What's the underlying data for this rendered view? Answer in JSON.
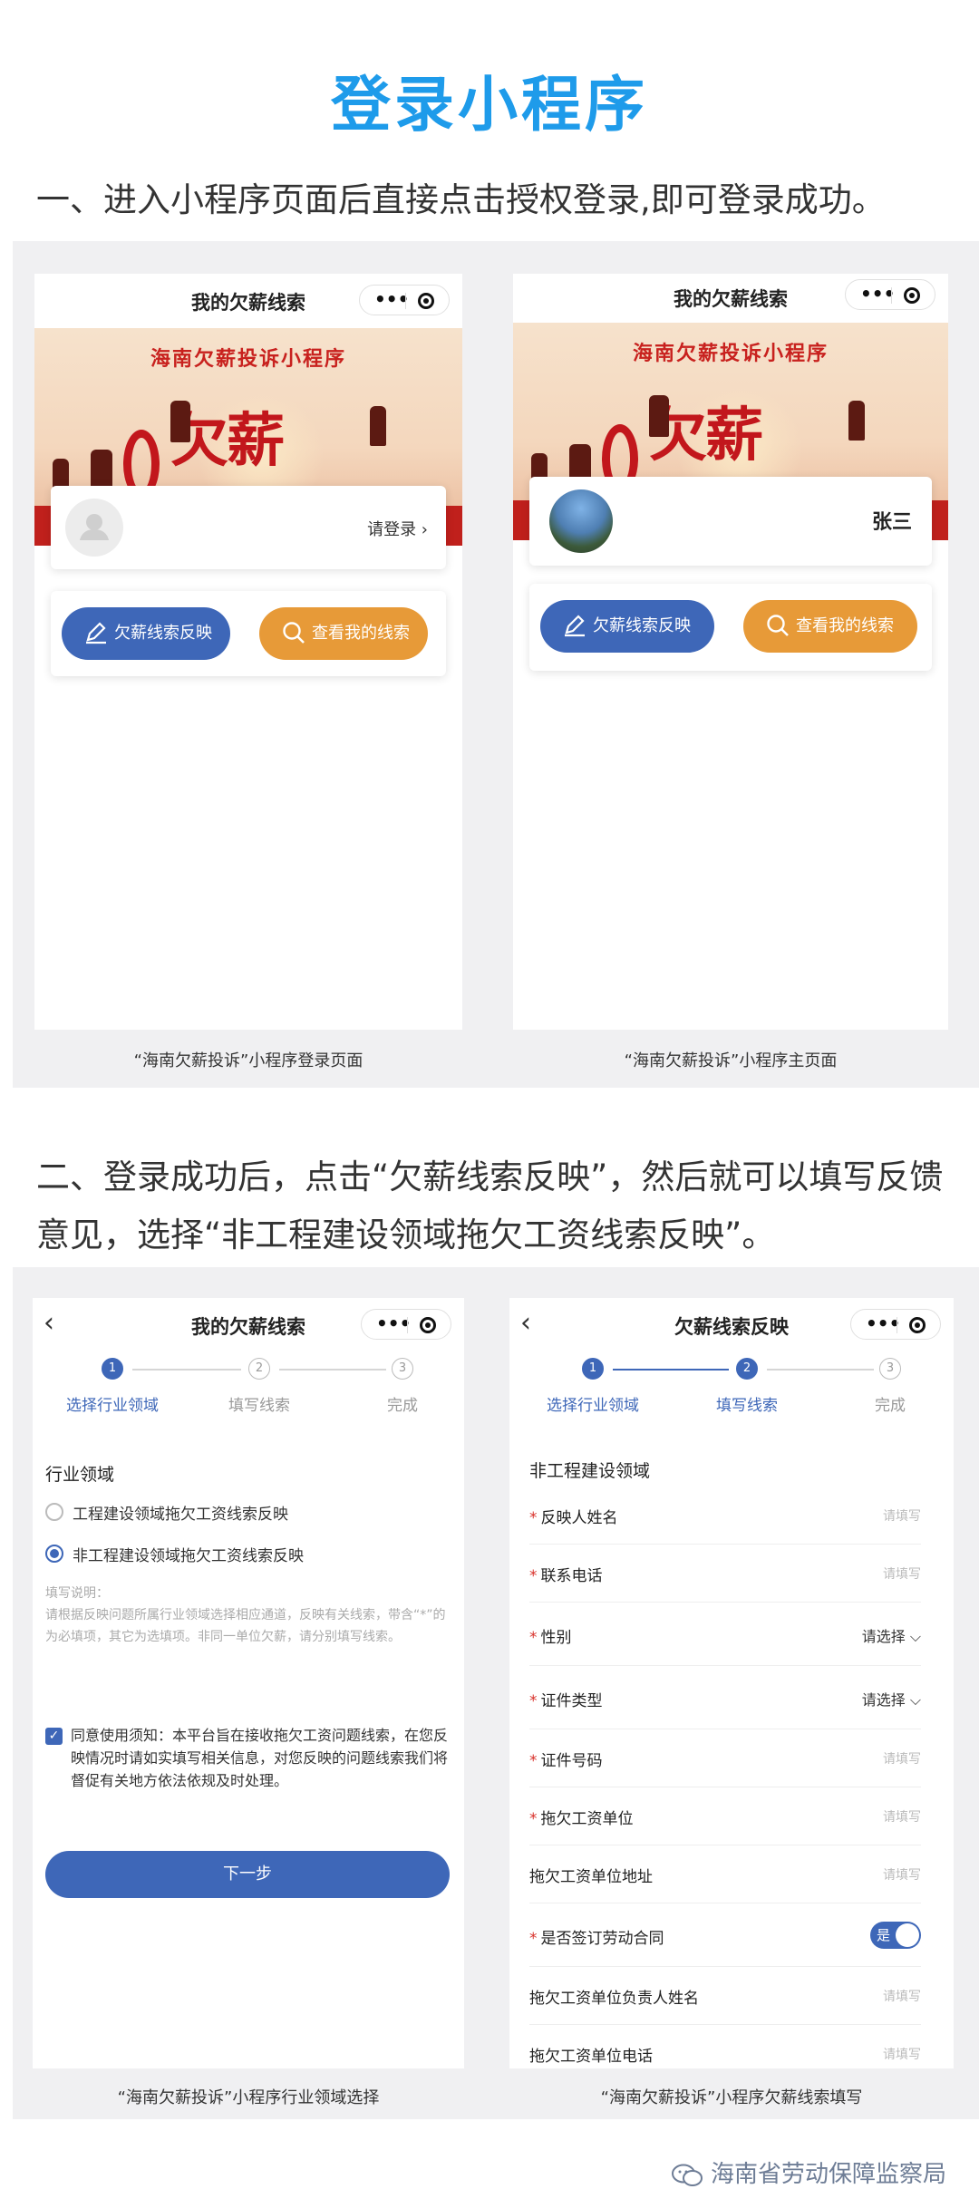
{
  "title": "登录小程序",
  "step1": "一、进入小程序页面后直接点击授权登录,即可登录成功。",
  "step2_line1": "二、登录成功后，点击“欠薪线索反映”，然后就可以填写反馈",
  "step2_line2": "意见，选择“非工程建设领域拖欠工资线索反映”。",
  "phone1": {
    "title": "我的欠薪线索",
    "banner": "海南欠薪投诉小程序",
    "big": "欠薪",
    "login": "请登录 ›",
    "btn_report": "欠薪线索反映",
    "btn_view": "查看我的线索",
    "caption": "“海南欠薪投诉”小程序登录页面"
  },
  "phone2": {
    "title": "我的欠薪线索",
    "banner": "海南欠薪投诉小程序",
    "big": "欠薪",
    "name": "张三",
    "btn_report": "欠薪线索反映",
    "btn_view": "查看我的线索",
    "caption": "“海南欠薪投诉”小程序主页面"
  },
  "phone3": {
    "title": "我的欠薪线索",
    "steps": [
      "选择行业领域",
      "填写线索",
      "完成"
    ],
    "section": "行业领域",
    "option1": "工程建设领域拖欠工资线索反映",
    "option2": "非工程建设领域拖欠工资线索反映",
    "hint_title": "填写说明：",
    "hint_body": "请根据反映问题所属行业领域选择相应通道，反映有关线索，带含“*”的为必填项，其它为选填项。非同一单位欠薪，请分别填写线索。",
    "notice": "同意使用须知：本平台旨在接收拖欠工资问题线索，在您反映情况时请如实填写相关信息，对您反映的问题线索我们将督促有关地方依法依规及时处理。",
    "next": "下一步",
    "caption": "“海南欠薪投诉”小程序行业领域选择"
  },
  "phone4": {
    "title": "欠薪线索反映",
    "steps": [
      "选择行业领域",
      "填写线索",
      "完成"
    ],
    "section": "非工程建设领域",
    "fields": [
      {
        "label": "反映人姓名",
        "required": true,
        "value": "请填写"
      },
      {
        "label": "联系电话",
        "required": true,
        "value": "请填写"
      },
      {
        "label": "性别",
        "required": true,
        "value": "请选择 ⌵"
      },
      {
        "label": "证件类型",
        "required": true,
        "value": "请选择 ⌵"
      },
      {
        "label": "证件号码",
        "required": true,
        "value": "请填写"
      },
      {
        "label": "拖欠工资单位",
        "required": true,
        "value": "请填写"
      },
      {
        "label": "拖欠工资单位地址",
        "required": false,
        "value": "请填写"
      },
      {
        "label": "是否签订劳动合同",
        "required": true,
        "value": "是"
      },
      {
        "label": "拖欠工资单位负责人姓名",
        "required": false,
        "value": "请填写"
      },
      {
        "label": "拖欠工资单位电话",
        "required": false,
        "value": "请填写"
      }
    ],
    "caption": "“海南欠薪投诉”小程序欠薪线索填写"
  },
  "watermark": "海南省劳动保障监察局",
  "colors": {
    "title_blue": "#1e9bea",
    "primary": "#3e67b8",
    "orange": "#e79a38",
    "banner_red": "#c2171c"
  }
}
